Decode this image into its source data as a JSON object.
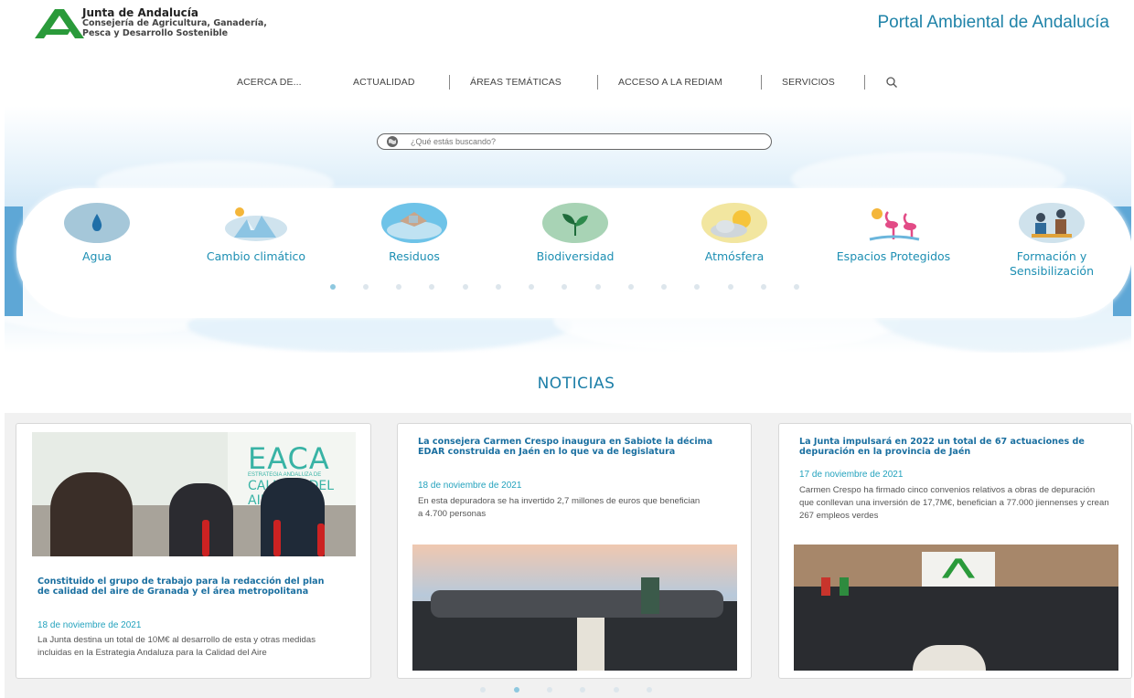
{
  "header": {
    "org_title": "Junta de Andalucía",
    "org_sub_line1": "Consejería de Agricultura, Ganadería,",
    "org_sub_line2": "Pesca y Desarrollo Sostenible",
    "portal_title": "Portal Ambiental de Andalucía",
    "logo_icon": "junta-andalucia-logo",
    "brand_color": "#2a9a3a",
    "accent_color": "#1f83a8"
  },
  "nav": {
    "items": [
      {
        "label": "ACERCA DE..."
      },
      {
        "label": "ACTUALIDAD"
      },
      {
        "label": "ÁREAS TEMÁTICAS"
      },
      {
        "label": "ACCESO A LA REDIAM"
      },
      {
        "label": "SERVICIOS"
      }
    ],
    "search_icon": "search-icon"
  },
  "search": {
    "placeholder": "¿Qué estás buscando?",
    "value": "",
    "icon": "globe-icon"
  },
  "topics": {
    "items": [
      {
        "label": "Agua",
        "icon": "water-drop-icon"
      },
      {
        "label": "Cambio climático",
        "icon": "climate-change-icon"
      },
      {
        "label": "Residuos",
        "icon": "waste-icon"
      },
      {
        "label": "Biodiversidad",
        "icon": "plant-sprout-icon"
      },
      {
        "label": "Atmósfera",
        "icon": "sun-cloud-icon"
      },
      {
        "label": "Espacios Protegidos",
        "icon": "flamingo-icon"
      },
      {
        "label": "Formación y Sensibilización",
        "icon": "education-icon"
      }
    ],
    "pages": 15,
    "active_page": 1
  },
  "news": {
    "section_title": "NOTICIAS",
    "cards": [
      {
        "title": "Constituido el grupo de trabajo para la redacción del plan de calidad del aire de Granada y el área metropolitana",
        "date": "18 de noviembre de 2021",
        "text": "La Junta destina un total de 10M€ al desarrollo de esta y otras medidas incluidas en la Estrategia Andaluza para la Calidad del Aire",
        "image_sign_big": "EACA",
        "image_sign_line1": "ESTRATEGIA ANDALUZA DE",
        "image_sign_line2": "CALIDAD DEL AIRE"
      },
      {
        "title": "La consejera Carmen Crespo inaugura en Sabiote la décima EDAR construida en Jaén en lo que va de legislatura",
        "date": "18 de noviembre de 2021",
        "text": "En esta depuradora se ha invertido 2,7 millones de euros que benefician a 4.700 personas"
      },
      {
        "title": "La Junta impulsará en 2022 un total de 67 actuaciones de depuración en la provincia de Jaén",
        "date": "17 de noviembre de 2021",
        "text": "Carmen Crespo ha firmado cinco convenios relativos a obras de depuración que conllevan una inversión de 17,7M€, benefician a 77.000 jiennenses y crean 267 empleos verdes"
      }
    ],
    "pages": 6,
    "active_page": 2
  }
}
